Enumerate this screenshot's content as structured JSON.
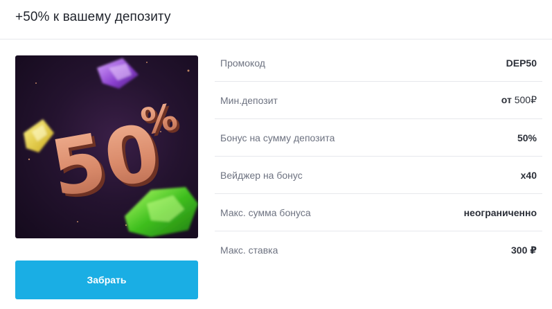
{
  "header": {
    "title": "+50% к вашему депозиту"
  },
  "promo_image": {
    "text": "50%",
    "colors": {
      "background": "#24132f",
      "text": "#d98a6a",
      "accent_green": "#3fbf1f",
      "accent_purple": "#8a3fcf",
      "accent_yellow": "#e8d21a"
    }
  },
  "button": {
    "label": "Забрать",
    "color": "#1aaee4"
  },
  "details": {
    "rows": [
      {
        "label": "Промокод",
        "value": "DEP50"
      },
      {
        "label": "Мин.депозит",
        "value_prefix": "от",
        "value": "500₽"
      },
      {
        "label": "Бонус на сумму депозита",
        "value": "50%"
      },
      {
        "label": "Вейджер на бонус",
        "value": "x40"
      },
      {
        "label": "Макс. сумма бонуса",
        "value": "неограниченно"
      },
      {
        "label": "Макс. ставка",
        "value": "300 ₽"
      }
    ]
  }
}
